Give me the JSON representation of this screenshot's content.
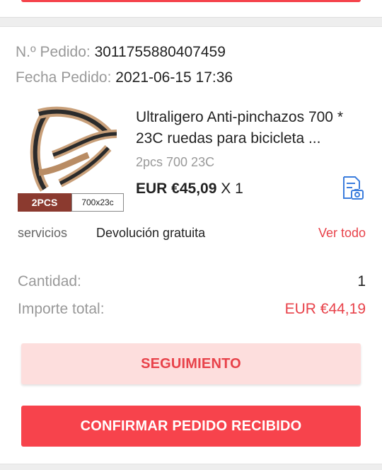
{
  "order": {
    "number_label": "N.º Pedido:",
    "number_value": "3011755880407459",
    "date_label": "Fecha Pedido:",
    "date_value": "2021-06-15 17:36"
  },
  "product": {
    "image_tag_qty": "2PCS",
    "image_tag_size": "700x23c",
    "title": "Ultraligero Anti-pinchazos 700 * 23C ruedas para bicicleta ...",
    "variant": "2pcs 700 23C",
    "price": "EUR €45,09",
    "quantity_text": "X 1"
  },
  "services": {
    "label": "servicios",
    "value": "Devolución gratuita",
    "link": "Ver todo"
  },
  "summary": {
    "quantity_label": "Cantidad:",
    "quantity_value": "1",
    "total_label": "Importe total:",
    "total_value": "EUR €44,19"
  },
  "buttons": {
    "tracking": "SEGUIMIENTO",
    "confirm": "CONFIRMAR PEDIDO RECIBIDO"
  },
  "colors": {
    "accent_red": "#f7434c",
    "accent_pink": "#fddedd",
    "link_red": "#e8424a",
    "icon_blue": "#3b7ddd"
  },
  "icons": {
    "invoice": "document-camera-icon"
  }
}
